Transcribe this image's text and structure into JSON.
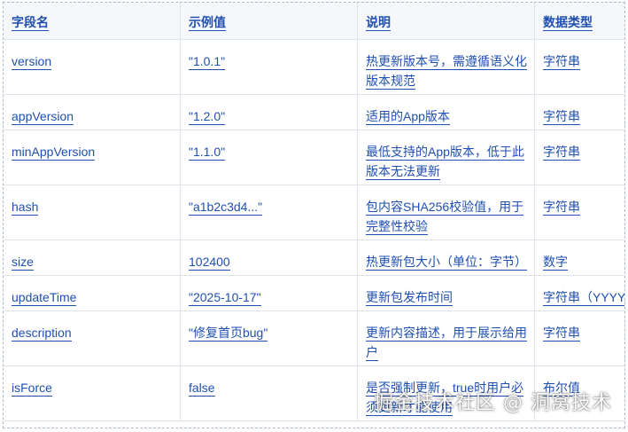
{
  "table": {
    "headers": [
      "字段名",
      "示例值",
      "说明",
      "数据类型"
    ],
    "rows": [
      {
        "field": "version",
        "example": "\"1.0.1\"",
        "desc": "热更新版本号，需遵循语义化版本规范",
        "type": "字符串"
      },
      {
        "field": "appVersion",
        "example": "\"1.2.0\"",
        "desc": "适用的App版本",
        "type": "字符串"
      },
      {
        "field": "minAppVersion",
        "example": "\"1.1.0\"",
        "desc": "最低支持的App版本，低于此版本无法更新",
        "type": "字符串"
      },
      {
        "field": "hash",
        "example": "\"a1b2c3d4...\"",
        "desc": "包内容SHA256校验值，用于完整性校验",
        "type": "字符串"
      },
      {
        "field": "size",
        "example": "102400",
        "desc": "热更新包大小（单位：字节）",
        "type": "数字"
      },
      {
        "field": "updateTime",
        "example": "\"2025-10-17\"",
        "desc": "更新包发布时间",
        "type": "字符串（YYYY"
      },
      {
        "field": "description",
        "example": "\"修复首页bug\"",
        "desc": "更新内容描述，用于展示给用户",
        "type": "字符串"
      },
      {
        "field": "isForce",
        "example": "false",
        "desc": "是否强制更新，true时用户必须更新才能使用",
        "type": "布尔值"
      }
    ]
  },
  "watermark": "掘金技术社区 @ 洞窝技术"
}
